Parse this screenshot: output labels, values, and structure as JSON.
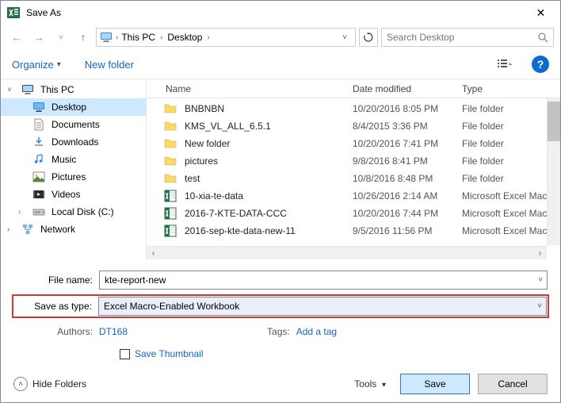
{
  "window": {
    "title": "Save As",
    "close": "✕"
  },
  "nav": {
    "path": [
      "This PC",
      "Desktop"
    ],
    "search_placeholder": "Search Desktop"
  },
  "toolbar": {
    "organize": "Organize",
    "new_folder": "New folder"
  },
  "sidebar": {
    "items": [
      {
        "label": "This PC",
        "icon": "pc",
        "exp": true
      },
      {
        "label": "Desktop",
        "icon": "monitor",
        "selected": true
      },
      {
        "label": "Documents",
        "icon": "doc"
      },
      {
        "label": "Downloads",
        "icon": "down"
      },
      {
        "label": "Music",
        "icon": "music"
      },
      {
        "label": "Pictures",
        "icon": "pic"
      },
      {
        "label": "Videos",
        "icon": "vid"
      },
      {
        "label": "Local Disk (C:)",
        "icon": "disk"
      },
      {
        "label": "Network",
        "icon": "net"
      }
    ]
  },
  "files": {
    "cols": {
      "name": "Name",
      "date": "Date modified",
      "type": "Type"
    },
    "rows": [
      {
        "name": "BNBNBN",
        "date": "10/20/2016 8:05 PM",
        "type": "File folder",
        "icon": "folder"
      },
      {
        "name": "KMS_VL_ALL_6.5.1",
        "date": "8/4/2015 3:36 PM",
        "type": "File folder",
        "icon": "folder"
      },
      {
        "name": "New folder",
        "date": "10/20/2016 7:41 PM",
        "type": "File folder",
        "icon": "folder"
      },
      {
        "name": "pictures",
        "date": "9/8/2016 8:41 PM",
        "type": "File folder",
        "icon": "folder"
      },
      {
        "name": "test",
        "date": "10/8/2016 8:48 PM",
        "type": "File folder",
        "icon": "folder"
      },
      {
        "name": "10-xia-te-data",
        "date": "10/26/2016 2:14 AM",
        "type": "Microsoft Excel Macro-",
        "icon": "excel"
      },
      {
        "name": "2016-7-KTE-DATA-CCC",
        "date": "10/20/2016 7:44 PM",
        "type": "Microsoft Excel Macro-",
        "icon": "excel"
      },
      {
        "name": "2016-sep-kte-data-new-11",
        "date": "9/5/2016 11:56 PM",
        "type": "Microsoft Excel Macro-",
        "icon": "excel"
      }
    ]
  },
  "form": {
    "filename_label": "File name:",
    "filename_value": "kte-report-new",
    "savetype_label": "Save as type:",
    "savetype_value": "Excel Macro-Enabled Workbook"
  },
  "meta": {
    "authors_label": "Authors:",
    "authors_value": "DT168",
    "tags_label": "Tags:",
    "tags_value": "Add a tag",
    "thumb_label": "Save Thumbnail"
  },
  "footer": {
    "hide_folders": "Hide Folders",
    "tools": "Tools",
    "save": "Save",
    "cancel": "Cancel"
  }
}
